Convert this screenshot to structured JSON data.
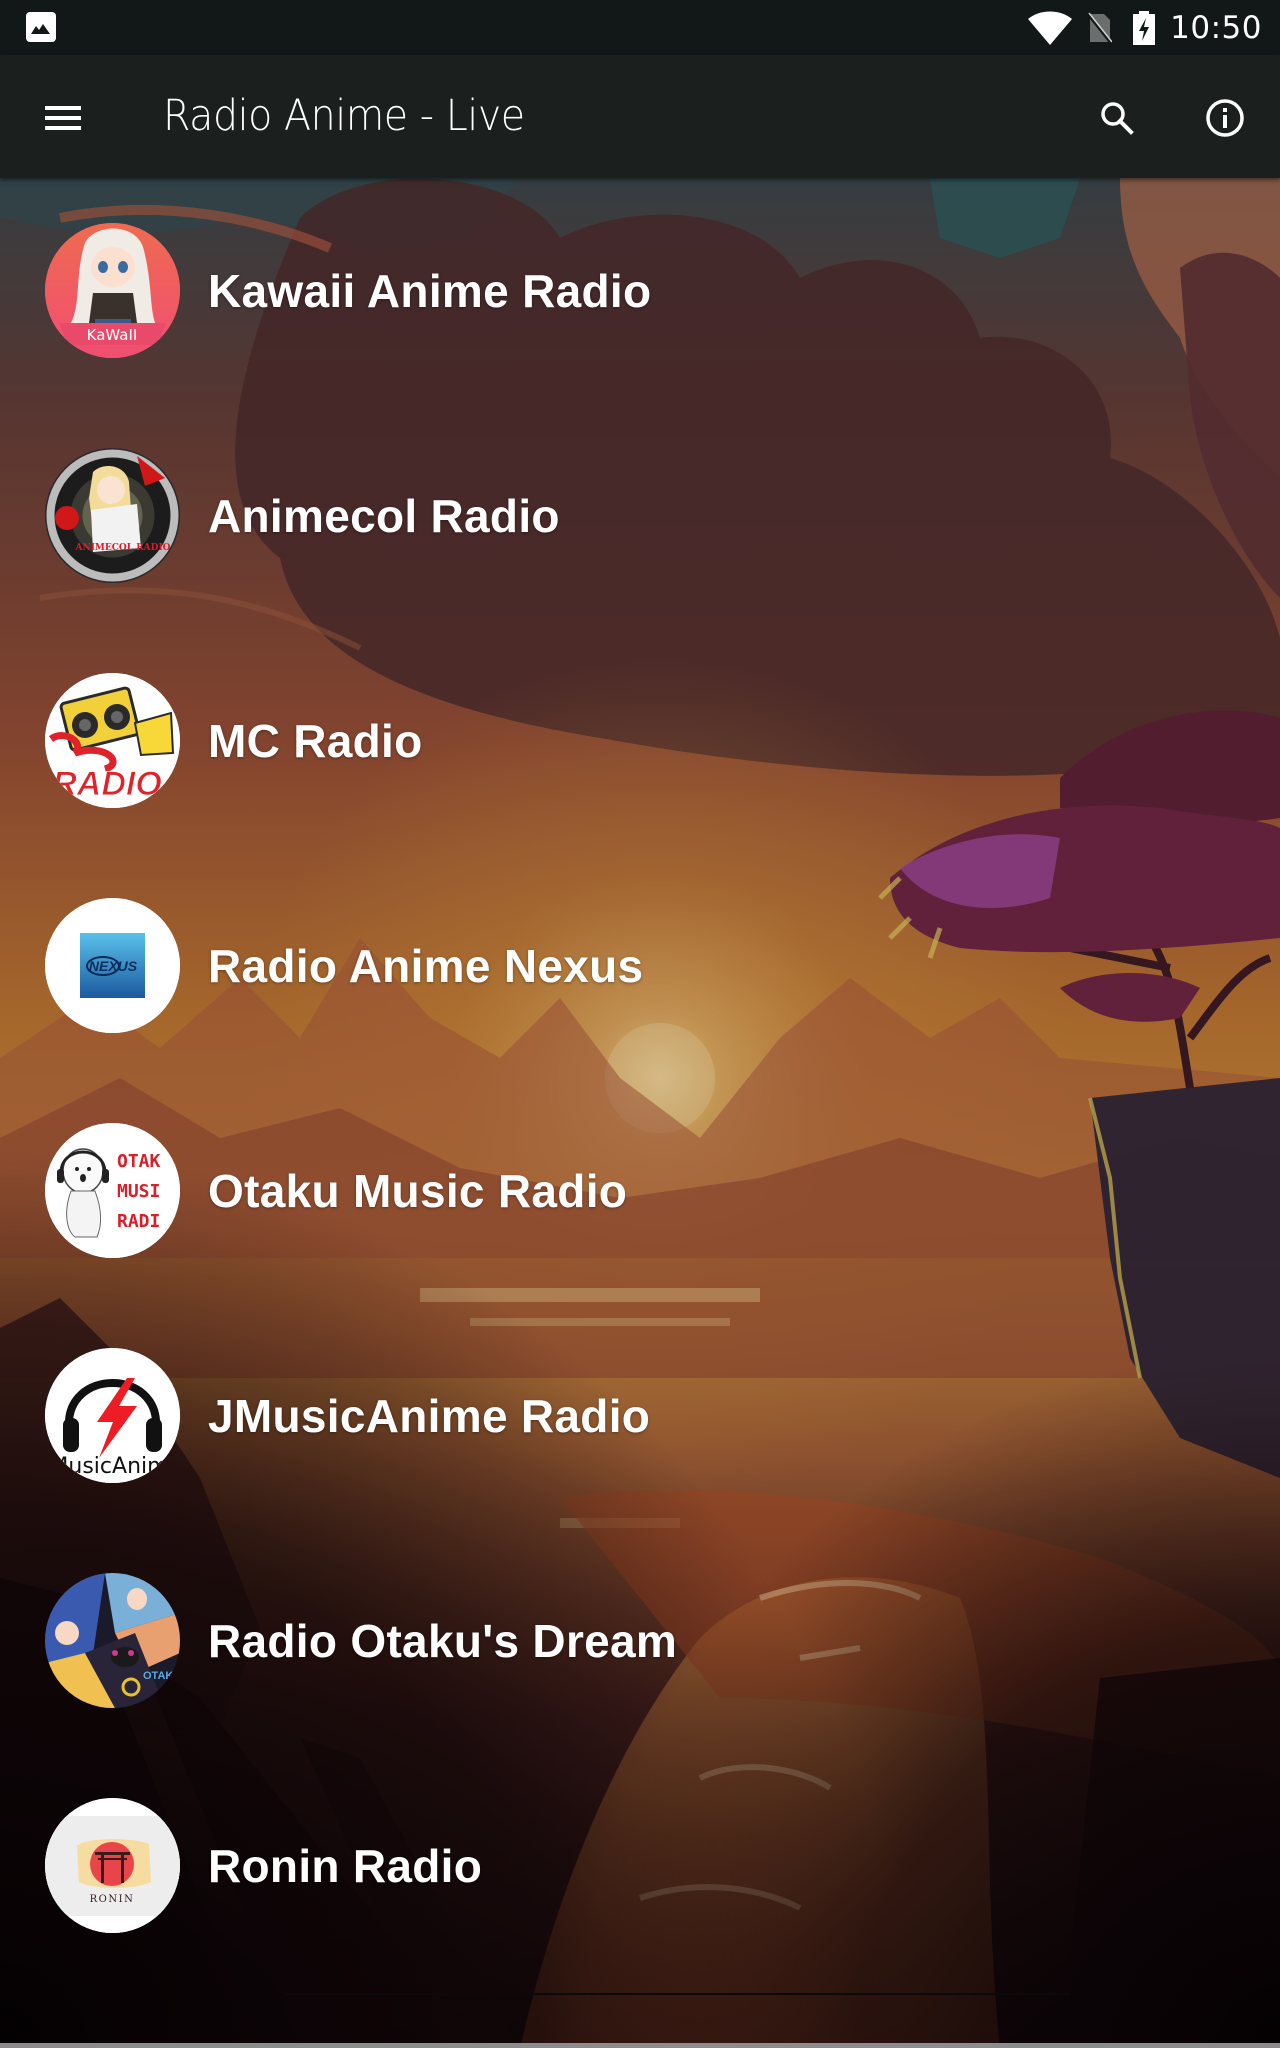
{
  "status_bar": {
    "time": "10:50",
    "icons": [
      "photo-icon",
      "wifi-icon",
      "no-sim-icon",
      "battery-charging-icon"
    ]
  },
  "app_bar": {
    "title": "Radio Anime - Live",
    "menu_icon": "hamburger-menu-icon",
    "actions": [
      {
        "name": "search",
        "icon": "search-icon"
      },
      {
        "name": "info",
        "icon": "info-icon"
      }
    ]
  },
  "stations": [
    {
      "name": "Kawaii Anime Radio",
      "logo_text": "KaWaII",
      "logo": "kawaii-logo"
    },
    {
      "name": "Animecol Radio",
      "logo_text": "ANIMECOL RADIO",
      "logo": "animecol-logo"
    },
    {
      "name": "MC Radio",
      "logo_text": "RADIO",
      "logo": "mc-radio-logo"
    },
    {
      "name": "Radio Anime Nexus",
      "logo_text": "NEXUS",
      "logo": "nexus-logo"
    },
    {
      "name": "Otaku Music Radio",
      "logo_text": "OTAKU MUSIC RADIO",
      "logo": "otaku-music-logo"
    },
    {
      "name": "JMusicAnime Radio",
      "logo_text": "MusicAnim",
      "logo": "jmusicanime-logo"
    },
    {
      "name": "Radio Otaku's Dream",
      "logo_text": "OTAKU DREAM",
      "logo": "otaku-dream-logo"
    },
    {
      "name": "Ronin Radio",
      "logo_text": "RONIN",
      "logo": "ronin-logo"
    }
  ],
  "colors": {
    "status_bar": "#121817",
    "app_bar": "#1b201f",
    "text": "#ffffff"
  }
}
